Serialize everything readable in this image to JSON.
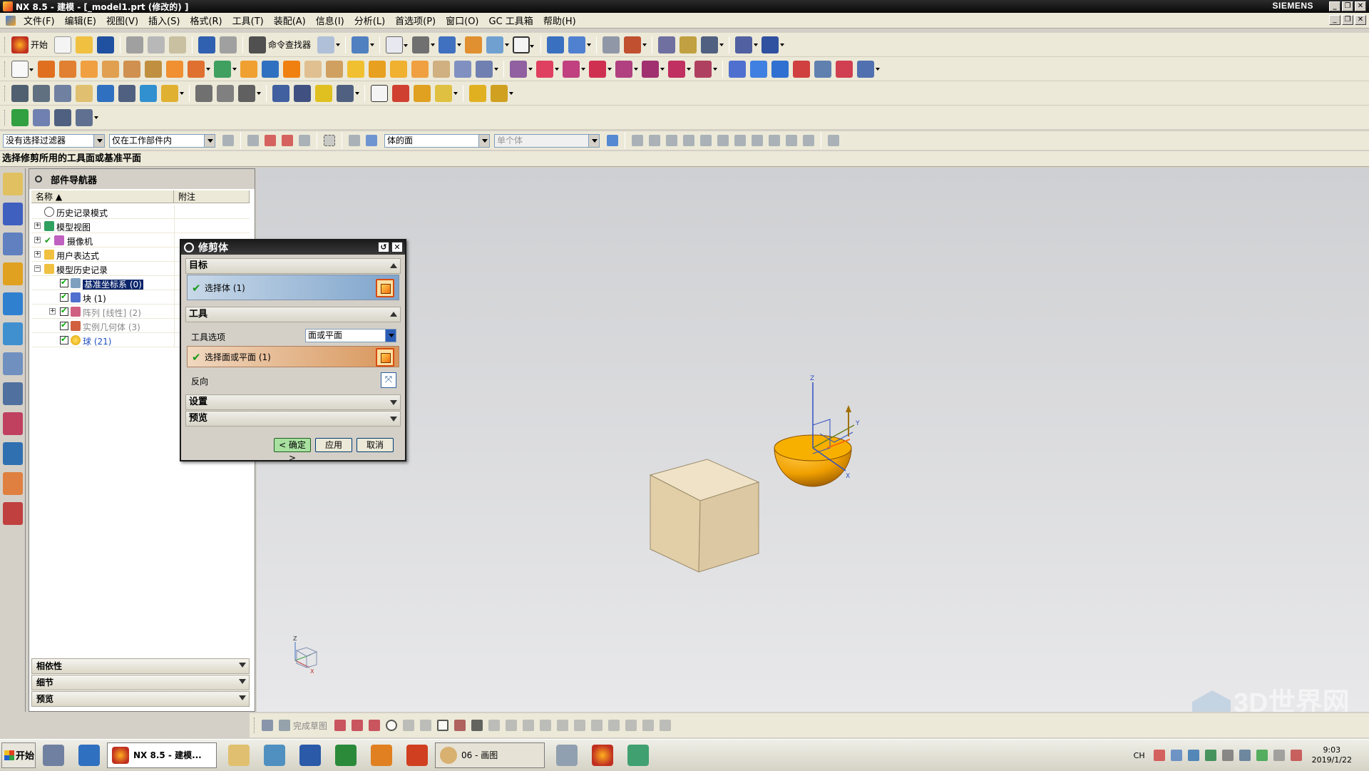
{
  "window": {
    "title": "NX 8.5 - 建模 - [_model1.prt  (修改的) ]",
    "brand": "SIEMENS"
  },
  "menu": [
    "文件(F)",
    "编辑(E)",
    "视图(V)",
    "插入(S)",
    "格式(R)",
    "工具(T)",
    "装配(A)",
    "信息(I)",
    "分析(L)",
    "首选项(P)",
    "窗口(O)",
    "GC 工具箱",
    "帮助(H)"
  ],
  "toolbar": {
    "start_label": "开始",
    "command_finder_label": "命令查找器"
  },
  "selection_bar": {
    "filter": "没有选择过滤器",
    "scope": "仅在工作部件内",
    "face_rule": "体的面",
    "body_rule": "单个体"
  },
  "cue": "选择修剪所用的工具面或基准平面",
  "navigator": {
    "title": "部件导航器",
    "columns": [
      "名称",
      "附注"
    ],
    "rows": [
      {
        "label": "历史记录模式"
      },
      {
        "label": "模型视图"
      },
      {
        "label": "摄像机"
      },
      {
        "label": "用户表达式"
      },
      {
        "label": "模型历史记录"
      },
      {
        "label": "基准坐标系 (0)"
      },
      {
        "label": "块 (1)"
      },
      {
        "label": "阵列 [线性] (2)"
      },
      {
        "label": "实例几何体 (3)"
      },
      {
        "label": "球 (21)"
      }
    ],
    "panels": [
      "相依性",
      "细节",
      "预览"
    ]
  },
  "dialog": {
    "title": "修剪体",
    "target_group": "目标",
    "select_body": "选择体 (1)",
    "tool_group": "工具",
    "tool_option_label": "工具选项",
    "tool_option_value": "面或平面",
    "select_face": "选择面或平面 (1)",
    "reverse_label": "反向",
    "settings_group": "设置",
    "preview_group": "预览",
    "ok": "< 确定 >",
    "apply": "应用",
    "cancel": "取消"
  },
  "viewport": {
    "axes": {
      "z": "Z",
      "y": "Y",
      "x": "X"
    },
    "triad": {
      "z": "Z",
      "y": "Y",
      "x": "X"
    },
    "watermark": "3D世界网"
  },
  "sketchbar": {
    "finish_label": "完成草图"
  },
  "taskbar": {
    "start": "开始",
    "nx_task": "NX 8.5 - 建模...",
    "paint_task": "06 - 画图",
    "lang": "CH",
    "time": "9:03",
    "date": "2019/1/22"
  },
  "colors": {
    "accent": "#0a246a",
    "sphere": "#f0a000",
    "block": "#e6d3b0",
    "select_green": "#1a9a1a",
    "select_orange": "#d84a10"
  }
}
